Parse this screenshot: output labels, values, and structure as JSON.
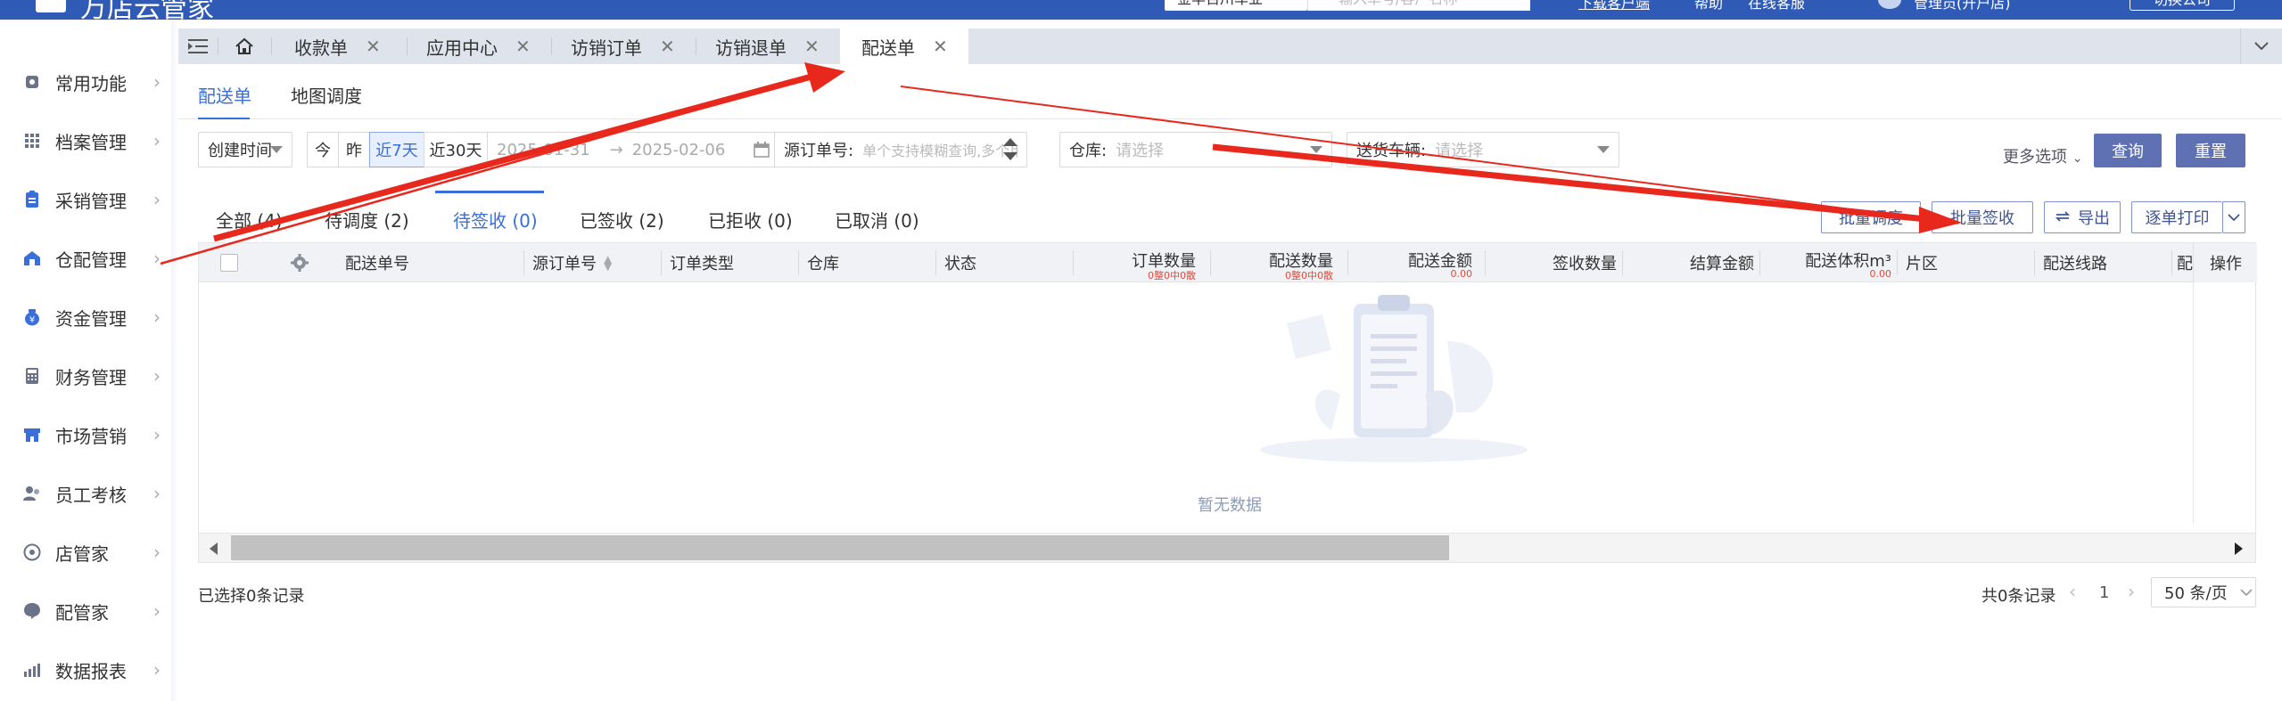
{
  "header": {
    "app_title": "万店云管家",
    "org_select": "金华百川车业",
    "search_placeholder": "输入单号/客户名称",
    "link_download": "下载客户端",
    "link_help": "帮助",
    "link_service": "在线客服",
    "user_name": "管理员(开户店)",
    "switch_button": "切换公司"
  },
  "sidebar": {
    "items": [
      {
        "label": "常用功能",
        "icon": "star-icon"
      },
      {
        "label": "档案管理",
        "icon": "grid-icon"
      },
      {
        "label": "采销管理",
        "icon": "clipboard-icon"
      },
      {
        "label": "仓配管理",
        "icon": "warehouse-icon"
      },
      {
        "label": "资金管理",
        "icon": "money-bag-icon"
      },
      {
        "label": "财务管理",
        "icon": "calculator-icon"
      },
      {
        "label": "市场营销",
        "icon": "store-icon"
      },
      {
        "label": "员工考核",
        "icon": "people-icon"
      },
      {
        "label": "店管家",
        "icon": "shop-icon"
      },
      {
        "label": "配管家",
        "icon": "chat-icon"
      },
      {
        "label": "数据报表",
        "icon": "chart-icon"
      }
    ]
  },
  "tabs": [
    {
      "label": "收款单"
    },
    {
      "label": "应用中心"
    },
    {
      "label": "访销订单"
    },
    {
      "label": "访销退单"
    },
    {
      "label": "配送单"
    }
  ],
  "subtabs": [
    "配送单",
    "地图调度"
  ],
  "filters": {
    "date_type": "创建时间",
    "day_buttons": [
      "今",
      "昨",
      "近7天",
      "近30天"
    ],
    "date_start": "2025-01-31",
    "date_arrow": "→",
    "date_end": "2025-02-06",
    "source_label": "源订单号:",
    "source_placeholder": "单个支持模糊查询,多个用逗号或空格分隔",
    "warehouse_label": "仓库:",
    "warehouse_placeholder": "请选择",
    "vehicle_label": "送货车辆:",
    "vehicle_placeholder": "请选择",
    "more_options": "更多选项",
    "query_button": "查询",
    "reset_button": "重置"
  },
  "status_tabs": [
    {
      "label": "全部",
      "count": "(4)"
    },
    {
      "label": "待调度",
      "count": "(2)"
    },
    {
      "label": "待签收",
      "count": "(0)"
    },
    {
      "label": "已签收",
      "count": "(2)"
    },
    {
      "label": "已拒收",
      "count": "(0)"
    },
    {
      "label": "已取消",
      "count": "(0)"
    }
  ],
  "actions": {
    "batch_dispatch": "批量调度",
    "batch_sign": "批量签收",
    "export": "导出",
    "print": "逐单打印"
  },
  "table": {
    "columns": [
      "配送单号",
      "源订单号",
      "订单类型",
      "仓库",
      "状态",
      "订单数量",
      "配送数量",
      "配送金额",
      "签收数量",
      "结算金额",
      "配送体积m³",
      "片区",
      "配送线路",
      "配"
    ],
    "sub_order_qty": "0整0中0散",
    "sub_delivery_qty": "0整0中0散",
    "sub_amount": "0.00",
    "sub_volume": "0.00",
    "op_column": "操作",
    "empty_text": "暂无数据"
  },
  "footer": {
    "selected": "已选择0条记录",
    "total": "共0条记录",
    "page": "1",
    "page_size": "50 条/页"
  },
  "colors": {
    "header_bg": "#2f5bb7",
    "accent": "#3a6ed8",
    "primary_button": "#5f71b2",
    "annotation_arrow": "#e8281c"
  }
}
